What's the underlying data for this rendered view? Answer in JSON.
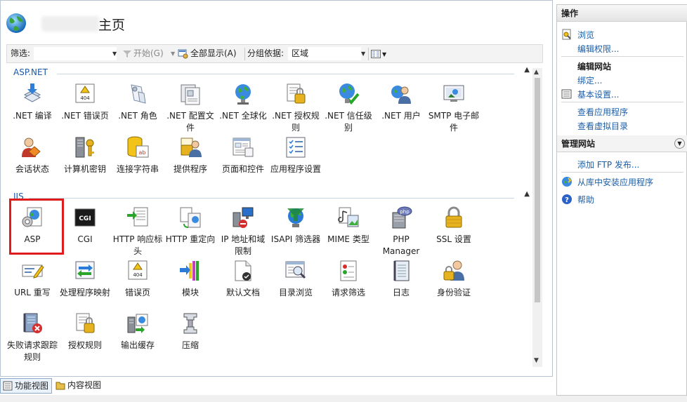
{
  "header": {
    "title": "主页"
  },
  "filterbar": {
    "filter_label": "筛选:",
    "filter_value": "",
    "start_label": "开始(G)",
    "show_all_label": "全部显示(A)",
    "group_by_label": "分组依据:",
    "group_by_value": "区域"
  },
  "groups": {
    "aspnet": {
      "name": "ASP.NET",
      "items": [
        {
          "label": ".NET 编译",
          "icon": "dotnet-compile-icon"
        },
        {
          "label": ".NET 错误页",
          "icon": "error-page-404-icon"
        },
        {
          "label": ".NET 角色",
          "icon": "roles-icon"
        },
        {
          "label": ".NET 配置文件",
          "icon": "profile-icon"
        },
        {
          "label": ".NET 全球化",
          "icon": "globe-icon"
        },
        {
          "label": ".NET 授权规则",
          "icon": "authorization-rules-icon"
        },
        {
          "label": ".NET 信任级别",
          "icon": "trust-level-icon"
        },
        {
          "label": ".NET 用户",
          "icon": "users-icon"
        },
        {
          "label": "SMTP 电子邮件",
          "icon": "smtp-mail-icon"
        },
        {
          "label": "会话状态",
          "icon": "session-state-icon"
        },
        {
          "label": "计算机密钥",
          "icon": "machine-key-icon"
        },
        {
          "label": "连接字符串",
          "icon": "connection-strings-icon"
        },
        {
          "label": "提供程序",
          "icon": "providers-icon"
        },
        {
          "label": "页面和控件",
          "icon": "pages-controls-icon"
        },
        {
          "label": "应用程序设置",
          "icon": "app-settings-icon"
        }
      ]
    },
    "iis": {
      "name": "IIS",
      "items": [
        {
          "label": "ASP",
          "icon": "asp-icon"
        },
        {
          "label": "CGI",
          "icon": "cgi-icon"
        },
        {
          "label": "HTTP 响应标头",
          "icon": "http-response-headers-icon"
        },
        {
          "label": "HTTP 重定向",
          "icon": "http-redirect-icon"
        },
        {
          "label": "IP 地址和域限制",
          "icon": "ip-domain-restrictions-icon"
        },
        {
          "label": "ISAPI 筛选器",
          "icon": "isapi-filters-icon"
        },
        {
          "label": "MIME 类型",
          "icon": "mime-types-icon"
        },
        {
          "label": "PHP Manager",
          "icon": "php-manager-icon"
        },
        {
          "label": "SSL 设置",
          "icon": "ssl-lock-icon"
        },
        {
          "label": "URL 重写",
          "icon": "url-rewrite-icon"
        },
        {
          "label": "处理程序映射",
          "icon": "handler-mappings-icon"
        },
        {
          "label": "错误页",
          "icon": "error-pages-icon"
        },
        {
          "label": "模块",
          "icon": "modules-icon"
        },
        {
          "label": "默认文档",
          "icon": "default-document-icon"
        },
        {
          "label": "目录浏览",
          "icon": "directory-browsing-icon"
        },
        {
          "label": "请求筛选",
          "icon": "request-filtering-icon"
        },
        {
          "label": "日志",
          "icon": "logging-icon"
        },
        {
          "label": "身份验证",
          "icon": "authentication-icon"
        },
        {
          "label": "失败请求跟踪规则",
          "icon": "failed-request-tracing-icon"
        },
        {
          "label": "授权规则",
          "icon": "authorization-icon"
        },
        {
          "label": "输出缓存",
          "icon": "output-caching-icon"
        },
        {
          "label": "压缩",
          "icon": "compression-icon"
        }
      ]
    }
  },
  "view_tabs": {
    "features": "功能视图",
    "content": "内容视图"
  },
  "actions": {
    "header": "操作",
    "browse": "浏览",
    "edit_permissions": "编辑权限...",
    "edit_site": "编辑网站",
    "bindings": "绑定...",
    "basic_settings": "基本设置...",
    "view_applications": "查看应用程序",
    "view_virtual_dirs": "查看虚拟目录",
    "manage_site": "管理网站",
    "add_ftp": "添加 FTP 发布...",
    "install_from_gallery": "从库中安装应用程序",
    "help": "帮助"
  },
  "colors": {
    "link": "#1b5faa",
    "group_title": "#1b59a8",
    "highlight": "#e01b1b"
  }
}
